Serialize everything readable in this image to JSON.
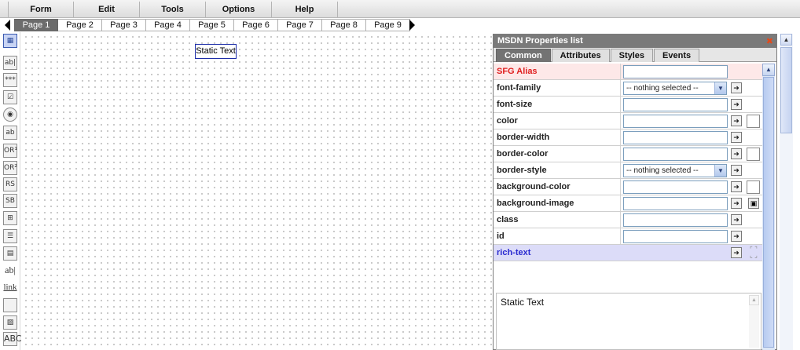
{
  "menu": [
    "Form",
    "Edit",
    "Tools",
    "Options",
    "Help"
  ],
  "page_tabs": [
    "Page 1",
    "Page 2",
    "Page 3",
    "Page 4",
    "Page 5",
    "Page 6",
    "Page 7",
    "Page 8",
    "Page 9"
  ],
  "active_page": "Page 1",
  "toolbox": {
    "tools": [
      "form-layout-icon",
      "text-input-icon",
      "password-input-icon",
      "checkbox-icon",
      "radio-button-icon",
      "textarea-icon",
      "radio-group-1-icon",
      "radio-group-2-icon",
      "radio-select-icon",
      "select-icon",
      "grid-icon",
      "list-icon",
      "table-icon",
      "label-icon",
      "link-icon",
      "button-icon",
      "image-icon",
      "spell-check-icon"
    ],
    "label_text": "ab|",
    "link_text": "link"
  },
  "canvas": {
    "static_text": "Static Text"
  },
  "properties": {
    "title": "MSDN Properties list",
    "tabs": [
      "Common",
      "Attributes",
      "Styles",
      "Events"
    ],
    "active_tab": "Common",
    "rows": {
      "sfg_alias": "SFG Alias",
      "font_family": "font-family",
      "font_size": "font-size",
      "color": "color",
      "border_width": "border-width",
      "border_color": "border-color",
      "border_style": "border-style",
      "background_color": "background-color",
      "background_image": "background-image",
      "class": "class",
      "id": "id",
      "rich_text": "rich-text"
    },
    "select_placeholder": "-- nothing selected --",
    "rich_text_value": "Static Text"
  },
  "colors": {
    "menu_bg": "#dcdcdc",
    "active_tab": "#6c6c6c",
    "panel_title": "#7a7a7a",
    "alias_label": "#e02020",
    "rich_label": "#2a2ad0",
    "selection_border": "#1c2ca8"
  }
}
